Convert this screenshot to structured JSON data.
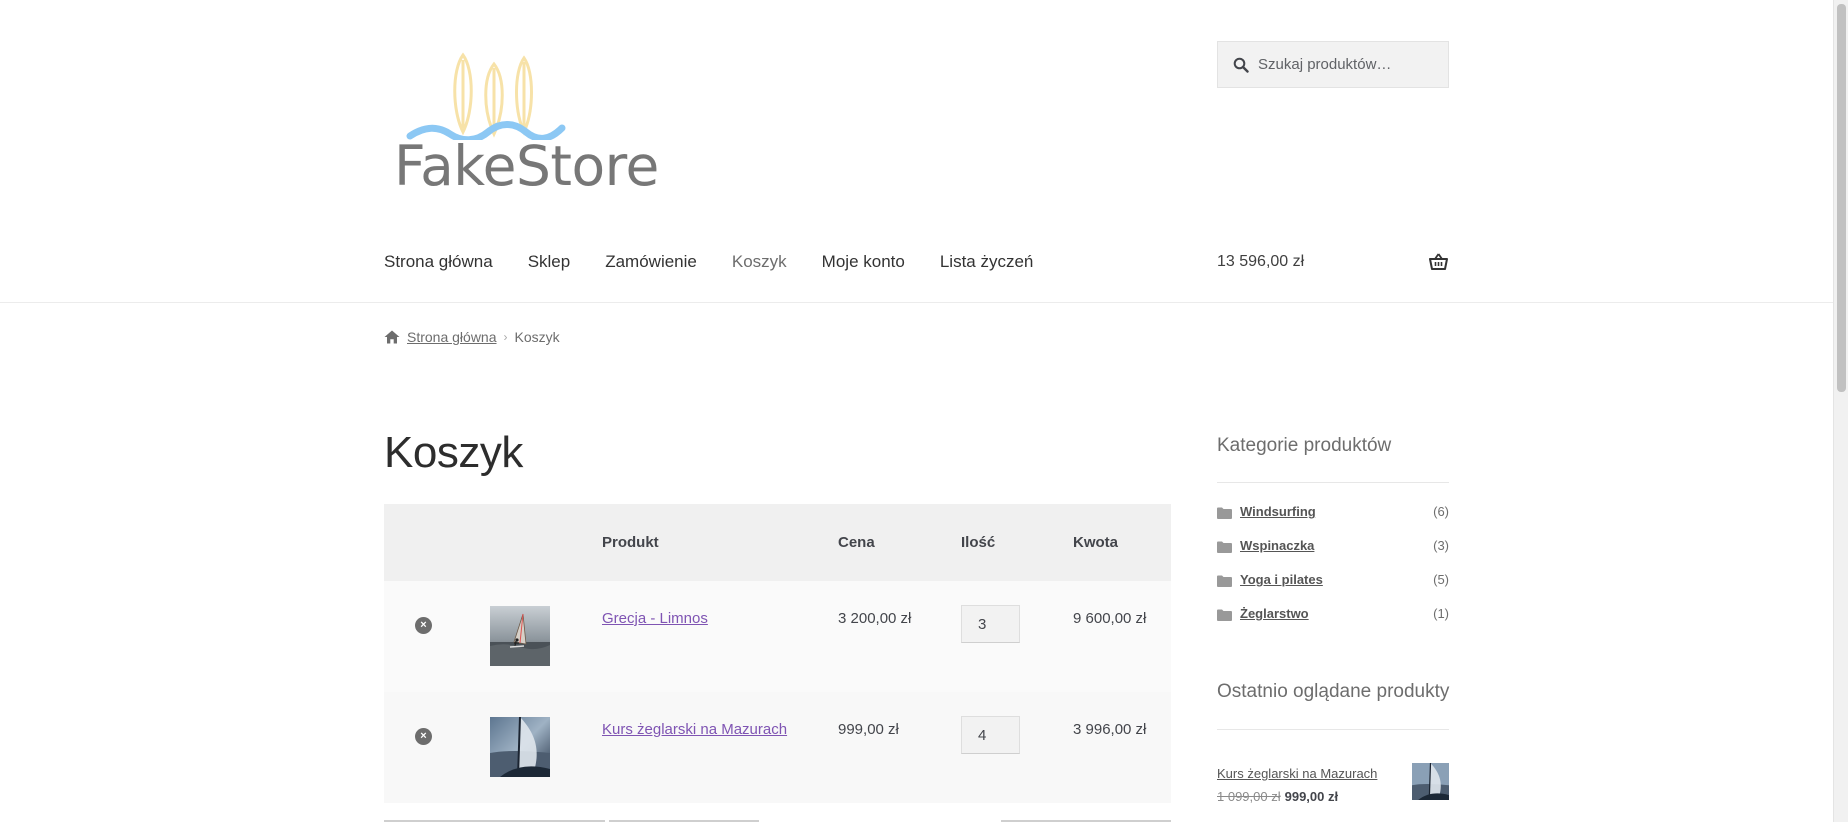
{
  "header": {
    "logo_text": "FakeStore",
    "search": {
      "placeholder": "Szukaj produktów…"
    },
    "nav": [
      {
        "label": "Strona główna",
        "active": false
      },
      {
        "label": "Sklep",
        "active": false
      },
      {
        "label": "Zamówienie",
        "active": false
      },
      {
        "label": "Koszyk",
        "active": true
      },
      {
        "label": "Moje konto",
        "active": false
      },
      {
        "label": "Lista życzeń",
        "active": false
      }
    ],
    "cart_total": "13 596,00 zł"
  },
  "breadcrumb": {
    "home_label": "Strona główna",
    "separator": "›",
    "current": "Koszyk"
  },
  "page": {
    "title": "Koszyk"
  },
  "cart": {
    "columns": {
      "product": "Produkt",
      "price": "Cena",
      "quantity": "Ilość",
      "subtotal": "Kwota"
    },
    "remove_symbol": "×",
    "items": [
      {
        "name": "Grecja - Limnos",
        "price": "3 200,00 zł",
        "quantity": "3",
        "subtotal": "9 600,00 zł",
        "image": "windsurfer-photo"
      },
      {
        "name": "Kurs żeglarski na Mazurach",
        "price": "999,00 zł",
        "quantity": "4",
        "subtotal": "3 996,00 zł",
        "image": "sailboat-photo"
      }
    ]
  },
  "sidebar": {
    "categories_title": "Kategorie produktów",
    "categories": [
      {
        "name": "Windsurfing",
        "count": "(6)"
      },
      {
        "name": "Wspinaczka",
        "count": "(3)"
      },
      {
        "name": "Yoga i pilates",
        "count": "(5)"
      },
      {
        "name": "Żeglarstwo",
        "count": "(1)"
      }
    ],
    "recent_title": "Ostatnio oglądane produkty",
    "recent": [
      {
        "name": "Kurs żeglarski na Mazurach",
        "old_price": "1 099,00 zł",
        "price": "999,00 zł",
        "image": "sailboat-photo"
      }
    ]
  },
  "colors": {
    "link_purple": "#7f54b3",
    "text": "#43454b",
    "table_header_bg": "#f0f0f0"
  }
}
